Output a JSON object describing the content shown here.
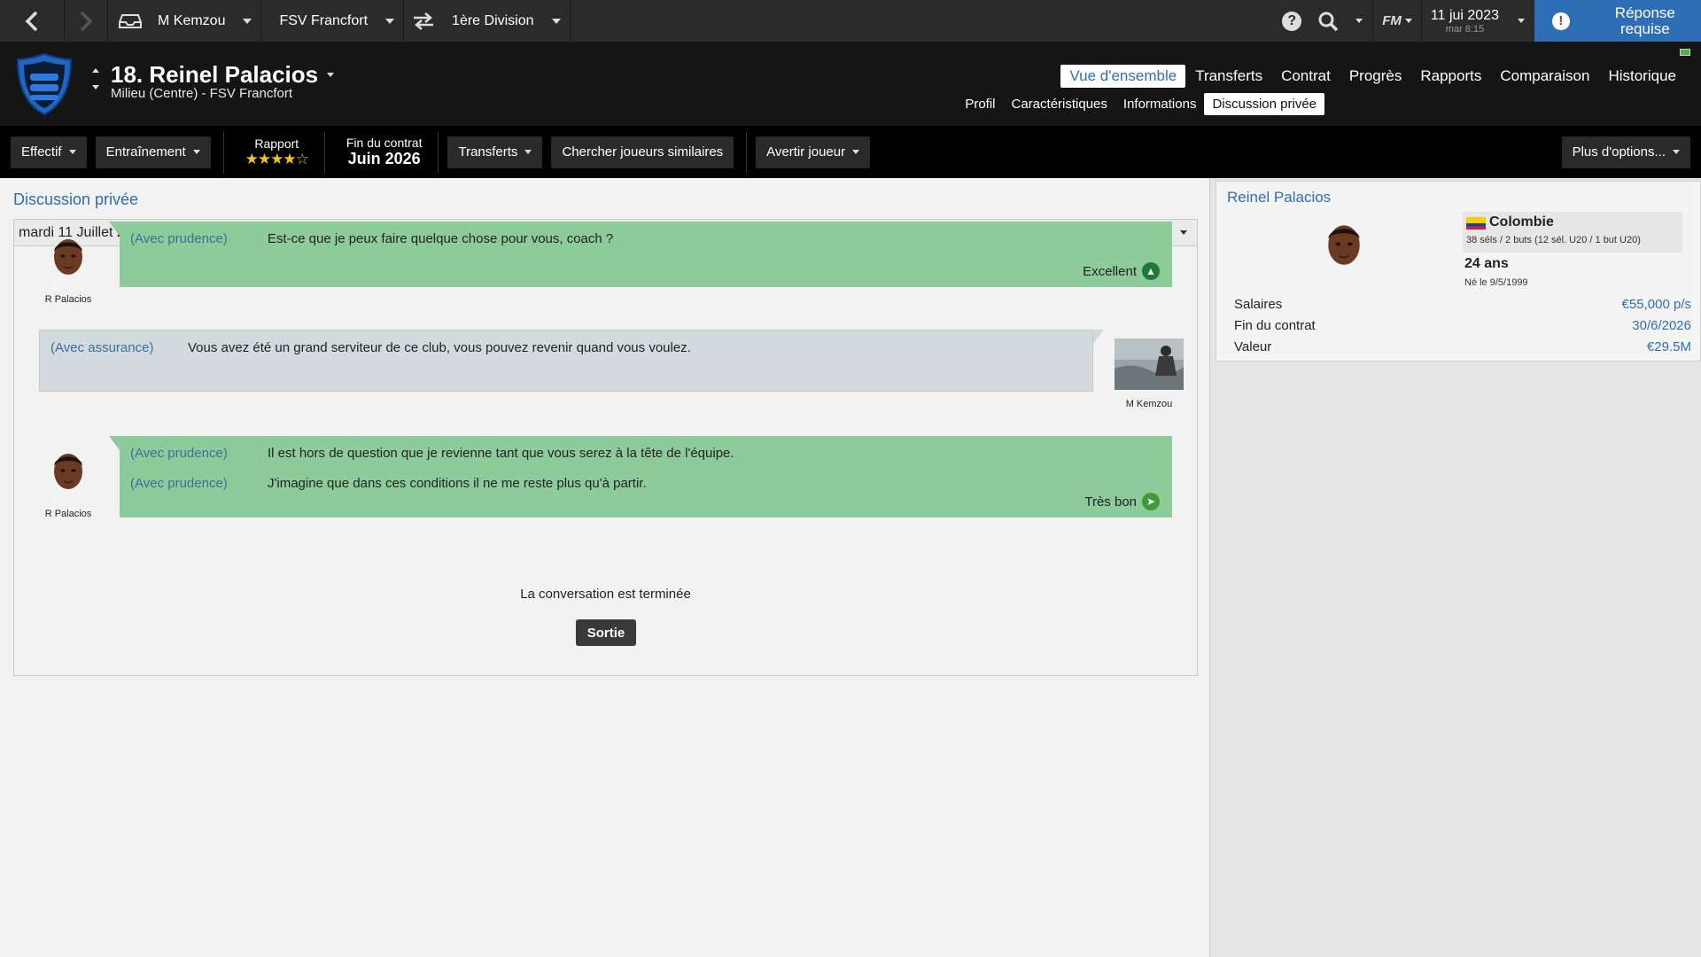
{
  "topbar": {
    "manager": "M Kemzou",
    "club": "FSV Francfort",
    "league": "1ère Division",
    "date": "11 jui 2023",
    "time": "mar 8:15",
    "fm_logo": "FM",
    "reply_label": "Réponse requise",
    "icons": [
      "back-arrow",
      "forward-arrow",
      "inbox-icon",
      "swap-icon",
      "help-icon",
      "search-icon",
      "alert-icon"
    ]
  },
  "header": {
    "player_title": "18. Reinel Palacios",
    "player_subtitle": "Milieu (Centre) - FSV Francfort",
    "nav_main": [
      "Vue d'ensemble",
      "Transferts",
      "Contrat",
      "Progrès",
      "Rapports",
      "Comparaison",
      "Historique"
    ],
    "nav_main_active": 0,
    "nav_sub": [
      "Profil",
      "Caractéristiques",
      "Informations",
      "Discussion privée"
    ],
    "nav_sub_active": 3
  },
  "toolbar": {
    "squad": "Effectif",
    "training": "Entraînement",
    "report_label": "Rapport",
    "report_stars": 4.5,
    "report_stars_glyph": "★★★★☆",
    "contract_label": "Fin du contrat",
    "contract_value": "Juin 2026",
    "transfers": "Transferts",
    "similar": "Chercher joueurs similaires",
    "warn": "Avertir joueur",
    "more": "Plus d'options..."
  },
  "main": {
    "title": "Discussion privée",
    "date": "mardi 11 Juillet 2023",
    "messages": [
      {
        "speaker": "R Palacios",
        "lines": [
          {
            "tone": "(Avec prudence)",
            "text": "Est-ce que je peux faire quelque chose pour vous, coach ?"
          }
        ],
        "result": "Excellent"
      },
      {
        "speaker": "M Kemzou",
        "lines": [
          {
            "tone": "(Avec assurance)",
            "text": "Vous avez été un grand serviteur de ce club, vous pouvez revenir quand vous voulez."
          }
        ]
      },
      {
        "speaker": "R Palacios",
        "lines": [
          {
            "tone": "(Avec prudence)",
            "text": "Il est hors de question que je revienne tant que vous serez à la tête de l'équipe."
          },
          {
            "tone": "(Avec prudence)",
            "text": "J'imagine que dans ces conditions il ne me reste plus qu'à partir."
          }
        ],
        "result": "Très bon"
      }
    ],
    "end_text": "La conversation est terminée",
    "exit_label": "Sortie"
  },
  "side": {
    "name": "Reinel Palacios",
    "nationality": "Colombie",
    "caps": "38 séls / 2 buts (12 sél. U20 / 1 but U20)",
    "age": "24 ans",
    "born": "Né le 9/5/1999",
    "rows": [
      {
        "label": "Salaires",
        "value": "€55,000 p/s"
      },
      {
        "label": "Fin du contrat",
        "value": "30/6/2026"
      },
      {
        "label": "Valeur",
        "value": "€29.5M"
      }
    ]
  },
  "colors": {
    "accent": "#2e6eb5",
    "player_bubble": "#8ecb9a",
    "manager_bubble": "#d2dadd",
    "result_icon": "#1f7a3a"
  }
}
